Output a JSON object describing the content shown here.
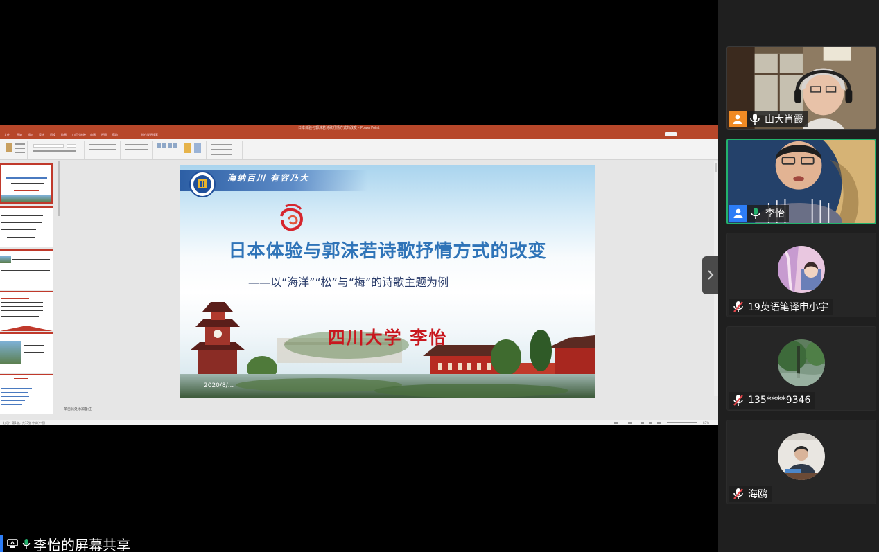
{
  "powerpoint": {
    "window_title": "日本体验与郭沫若诗歌抒情方式的改变 - PowerPoint",
    "tabs": [
      "文件",
      "开始",
      "插入",
      "设计",
      "切换",
      "动画",
      "幻灯片放映",
      "审阅",
      "视图",
      "帮助",
      "操作说明搜索"
    ],
    "notes_placeholder": "单击此处添加备注",
    "status_text": "幻灯片 第1张，共15张   中文(中国)",
    "zoom": "85%"
  },
  "slide": {
    "motto": "海纳百川 有容乃大",
    "title": "日本体验与郭沫若诗歌抒情方式的改变",
    "subtitle": "——以“海洋”“松”与“梅”的诗歌主题为例",
    "author": "四川大学  李怡",
    "date": "2020/8/..."
  },
  "share": {
    "label": "李怡的屏幕共享"
  },
  "participants": [
    {
      "name": "山大肖霞",
      "type": "video"
    },
    {
      "name": "李怡",
      "type": "video",
      "speaking": true
    },
    {
      "name": "19英语笔译申小宇",
      "type": "avatar",
      "muted": true
    },
    {
      "name": "135****9346",
      "type": "avatar",
      "muted": true
    },
    {
      "name": "海鸥",
      "type": "avatar",
      "muted": true
    }
  ],
  "colors": {
    "ppt_accent": "#b7472a",
    "speaking_border": "#23b26d",
    "badge_orange": "#f08a24",
    "badge_blue": "#2d7df6",
    "muted_red": "#e5484d",
    "title_blue": "#2f74b8",
    "author_red": "#c8171e"
  }
}
